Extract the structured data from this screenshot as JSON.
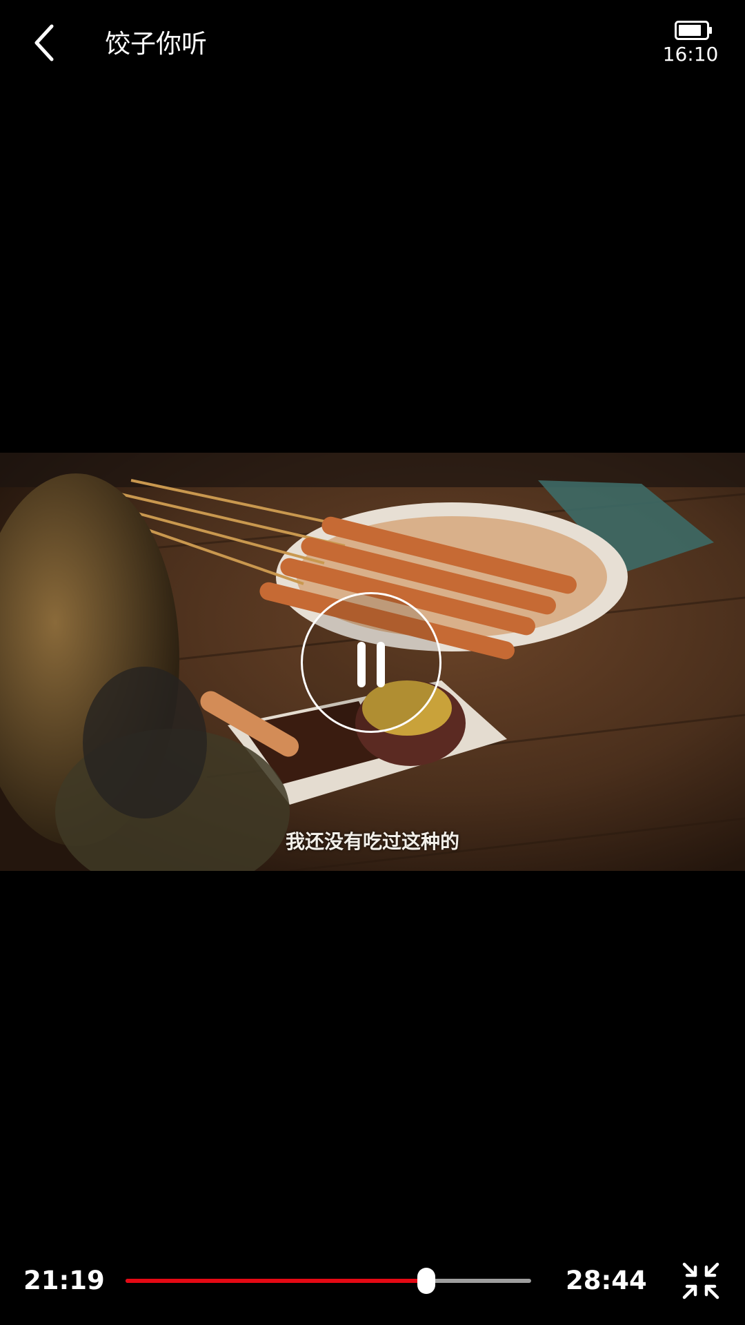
{
  "header": {
    "title": "饺子你听",
    "back_icon": "chevron-left-icon"
  },
  "status": {
    "battery_icon": "battery-icon",
    "time": "16:10"
  },
  "video": {
    "subtitle": "我还没有吃过这种的",
    "state": "playing",
    "pause_icon": "pause-icon"
  },
  "controls": {
    "current_time": "21:19",
    "total_time": "28:44",
    "progress": 0.7414,
    "progress_color": "#e50914",
    "track_color": "#9e9e9e",
    "exit_fullscreen_icon": "exit-fullscreen-icon"
  }
}
